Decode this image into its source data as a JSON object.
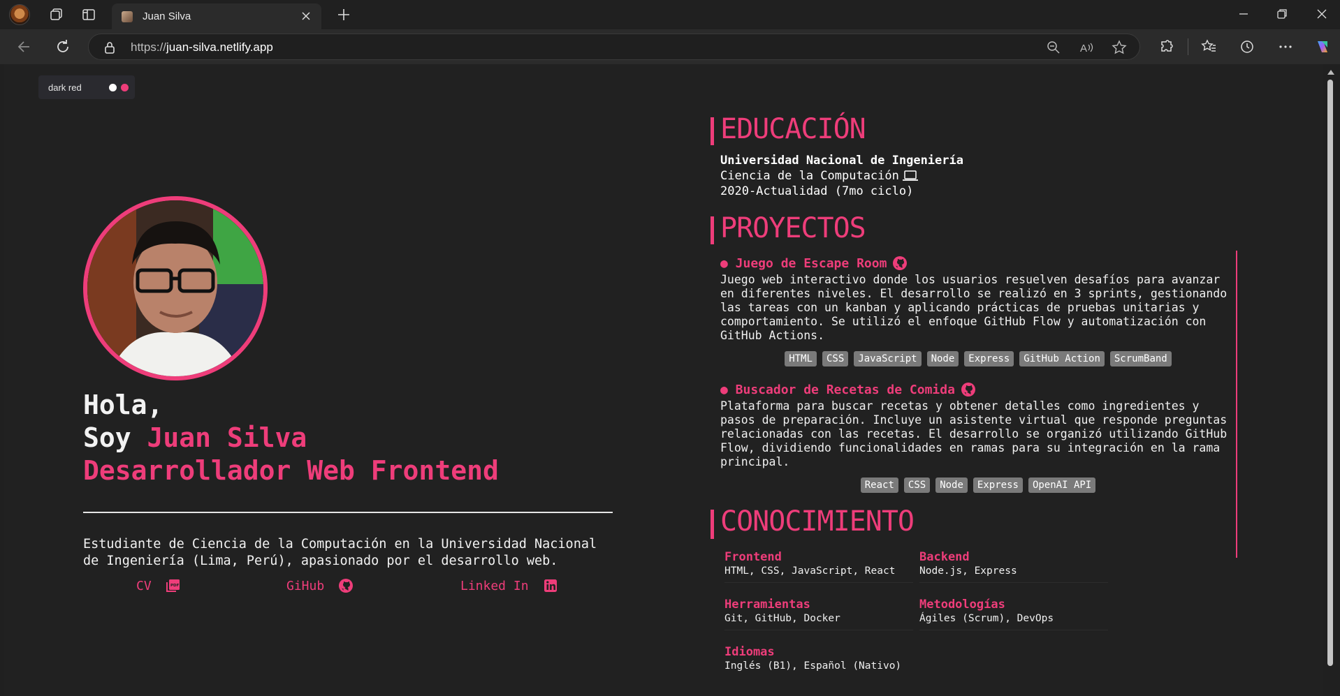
{
  "browser": {
    "tab_title": "Juan Silva",
    "url_scheme": "https://",
    "url_host": "juan-silva.netlify.app"
  },
  "page": {
    "theme_toggle_label": "dark red",
    "hero": {
      "greeting": "Hola,",
      "soy": "Soy ",
      "name": "Juan Silva",
      "role": "Desarrollador Web Frontend",
      "about": "Estudiante de Ciencia de la Computación en la Universidad Nacional de Ingeniería (Lima, Perú), apasionado por el desarrollo web."
    },
    "links": [
      {
        "label": "CV",
        "icon": "pdf-icon"
      },
      {
        "label": "GiHub",
        "icon": "github-icon"
      },
      {
        "label": "Linked In",
        "icon": "linkedin-icon"
      }
    ],
    "education": {
      "title": "EDUCACIÓN",
      "university": "Universidad Nacional de Ingeniería",
      "career": "Ciencia de la Computación",
      "period": "2020-Actualidad (7mo ciclo)"
    },
    "projects": {
      "title": "PROYECTOS",
      "items": [
        {
          "name": "● Juego de Escape Room",
          "description": "Juego web interactivo donde los usuarios resuelven desafíos para avanzar en diferentes niveles. El desarrollo se realizó en 3 sprints, gestionando las tareas con un kanban y aplicando prácticas de pruebas unitarias y comportamiento. Se utilizó el enfoque GitHub Flow y automatización con GitHub Actions.",
          "tags": [
            "HTML",
            "CSS",
            "JavaScript",
            "Node",
            "Express",
            "GitHub Action",
            "ScrumBand"
          ]
        },
        {
          "name": "● Buscador de Recetas de Comida",
          "description": "Plataforma para buscar recetas y obtener detalles como ingredientes y pasos de preparación. Incluye un asistente virtual que responde preguntas relacionadas con las recetas. El desarrollo se organizó utilizando GitHub Flow, dividiendo funcionalidades en ramas para su integración en la rama principal.",
          "tags": [
            "React",
            "CSS",
            "Node",
            "Express",
            "OpenAI API"
          ]
        }
      ]
    },
    "knowledge": {
      "title": "CONOCIMIENTO",
      "items": [
        {
          "heading": "Frontend",
          "value": "HTML, CSS, JavaScript, React"
        },
        {
          "heading": "Backend",
          "value": "Node.js, Express"
        },
        {
          "heading": "Herramientas",
          "value": "Git, GitHub, Docker"
        },
        {
          "heading": "Metodologías",
          "value": "Ágiles (Scrum), DevOps"
        },
        {
          "heading": "Idiomas",
          "value": "Inglés (B1), Español (Nativo)"
        }
      ]
    }
  },
  "colors": {
    "accent": "#ee3d7a",
    "background": "#212121",
    "tag_bg": "#7a7a7a"
  }
}
